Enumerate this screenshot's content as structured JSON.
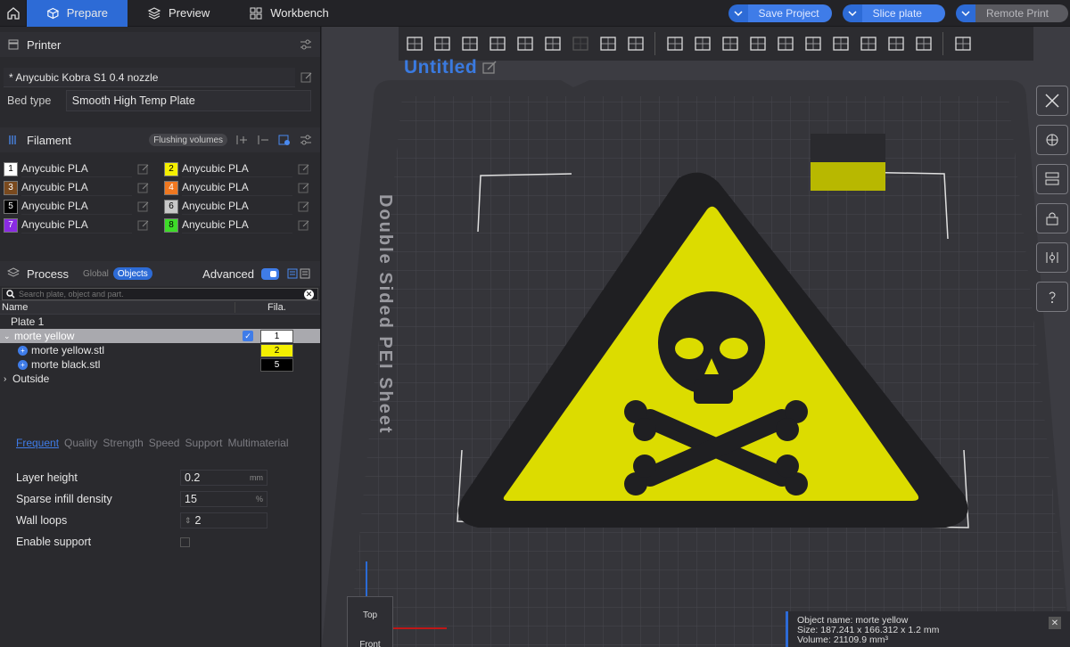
{
  "topbar": {
    "tabs": [
      {
        "label": "Prepare",
        "active": true
      },
      {
        "label": "Preview"
      },
      {
        "label": "Workbench"
      }
    ],
    "save_project": "Save Project",
    "slice_plate": "Slice plate",
    "remote_print": "Remote Print"
  },
  "printer": {
    "title": "Printer",
    "preset": "* Anycubic Kobra S1 0.4 nozzle",
    "bed_type_label": "Bed type",
    "bed_type": "Smooth High Temp Plate"
  },
  "filament": {
    "title": "Filament",
    "flushing": "Flushing volumes",
    "items": [
      {
        "num": "1",
        "name": "Anycubic PLA",
        "color": "#ffffff",
        "text": "#000000"
      },
      {
        "num": "2",
        "name": "Anycubic PLA",
        "color": "#f5f000",
        "text": "#000000"
      },
      {
        "num": "3",
        "name": "Anycubic PLA",
        "color": "#7a4a1e",
        "text": "#ffffff"
      },
      {
        "num": "4",
        "name": "Anycubic PLA",
        "color": "#f07820",
        "text": "#ffffff"
      },
      {
        "num": "5",
        "name": "Anycubic PLA",
        "color": "#000000",
        "text": "#ffffff"
      },
      {
        "num": "6",
        "name": "Anycubic PLA",
        "color": "#c8c8c8",
        "text": "#000000"
      },
      {
        "num": "7",
        "name": "Anycubic PLA",
        "color": "#8a2be2",
        "text": "#ffffff"
      },
      {
        "num": "8",
        "name": "Anycubic PLA",
        "color": "#3ddc28",
        "text": "#000000"
      }
    ]
  },
  "process": {
    "title": "Process",
    "global": "Global",
    "objects": "Objects",
    "advanced": "Advanced",
    "search_placeholder": "Search plate, object and part."
  },
  "tree": {
    "col_name": "Name",
    "col_fila": "Fila.",
    "plate": "Plate 1",
    "object": "morte yellow",
    "object_fila": "1",
    "parts": [
      {
        "name": "morte yellow.stl",
        "fila": "2",
        "color": "#f5f000",
        "text": "#000000"
      },
      {
        "name": "morte black.stl",
        "fila": "5",
        "color": "#000000",
        "text": "#ffffff"
      }
    ],
    "outside": "Outside"
  },
  "categories": [
    "Frequent",
    "Quality",
    "Strength",
    "Speed",
    "Support",
    "Multimaterial"
  ],
  "params": [
    {
      "label": "Layer height",
      "value": "0.2",
      "unit": "mm"
    },
    {
      "label": "Sparse infill density",
      "value": "15",
      "unit": "%"
    },
    {
      "label": "Wall loops",
      "value": "2",
      "unit": ""
    },
    {
      "label": "Enable support",
      "value": "",
      "unit": ""
    }
  ],
  "viewport": {
    "project_title": "Untitled",
    "plate_label": "Double Sided PEI Sheet",
    "view_cube_top": "Top",
    "view_cube_front": "Front",
    "info_name": "Object name: morte yellow",
    "info_size": "Size: 187.241 x 166.312 x 1.2 mm",
    "info_volume": "Volume: 21109.9 mm³"
  },
  "colors": {
    "accent": "#2d6bd6",
    "hazard_yellow": "#dcdc00",
    "hazard_black": "#1f1f22"
  }
}
